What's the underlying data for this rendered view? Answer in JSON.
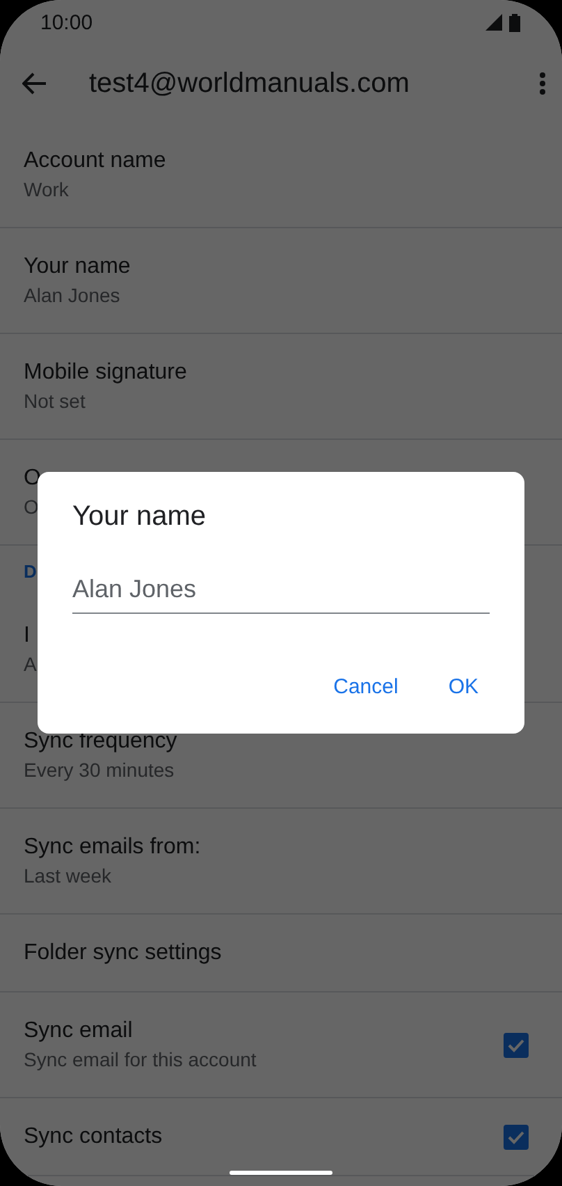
{
  "status_bar": {
    "time": "10:00"
  },
  "app_bar": {
    "title": "test4@worldmanuals.com"
  },
  "settings": [
    {
      "kind": "item",
      "title": "Account name",
      "subtitle": "Work"
    },
    {
      "kind": "item",
      "title": "Your name",
      "subtitle": "Alan Jones"
    },
    {
      "kind": "item",
      "title": "Mobile signature",
      "subtitle": "Not set"
    },
    {
      "kind": "item",
      "title": "O",
      "subtitle": "O"
    },
    {
      "kind": "header",
      "title": "D"
    },
    {
      "kind": "item",
      "title": "I",
      "subtitle": "A"
    },
    {
      "kind": "item",
      "title": "Sync frequency",
      "subtitle": "Every 30 minutes"
    },
    {
      "kind": "item",
      "title": "Sync emails from:",
      "subtitle": "Last week"
    },
    {
      "kind": "item",
      "title": "Folder sync settings"
    },
    {
      "kind": "checkbox",
      "title": "Sync email",
      "subtitle": "Sync email for this account",
      "checked": true
    },
    {
      "kind": "checkbox",
      "title": "Sync contacts",
      "checked": true
    }
  ],
  "dialog": {
    "title": "Your name",
    "value": "Alan Jones",
    "buttons": [
      "Cancel",
      "OK"
    ]
  }
}
